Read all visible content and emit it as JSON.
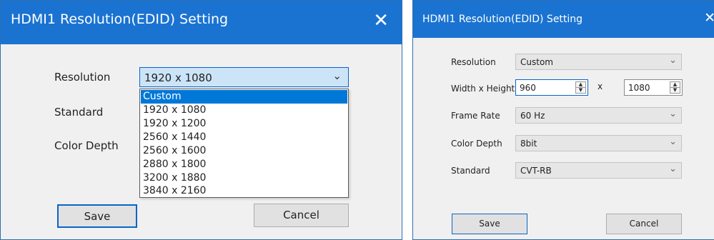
{
  "left_dialog": {
    "title": "HDMI1 Resolution(EDID) Setting",
    "close_glyph": "✕",
    "labels": {
      "resolution": "Resolution",
      "standard": "Standard",
      "color_depth": "Color Depth"
    },
    "resolution_value": "1920 x 1080",
    "dropdown_options": [
      "Custom",
      "1920 x 1080",
      "1920 x 1200",
      "2560 x 1440",
      "2560 x 1600",
      "2880 x 1800",
      "3200 x 1880",
      "3840 x 2160"
    ],
    "highlighted_option": "Custom",
    "save_label": "Save",
    "cancel_label": "Cancel"
  },
  "right_dialog": {
    "title": "HDMI1 Resolution(EDID) Setting",
    "close_glyph": "✕",
    "labels": {
      "resolution": "Resolution",
      "width_height": "Width x Height",
      "frame_rate": "Frame Rate",
      "color_depth": "Color Depth",
      "standard": "Standard"
    },
    "resolution_value": "Custom",
    "width_value": "960",
    "separator": "x",
    "height_value": "1080",
    "frame_rate_value": "60 Hz",
    "color_depth_value": "8bit",
    "standard_value": "CVT-RB",
    "save_label": "Save",
    "cancel_label": "Cancel"
  },
  "colors": {
    "titlebar": "#1a73d1",
    "dialog_bg": "#f0f0f0",
    "selection": "#0078d7",
    "focus_border": "#0a64c8"
  },
  "icons": {
    "dropdown": "chevron-down-icon",
    "close": "close-icon",
    "spin": "spinner-arrows-icon"
  }
}
